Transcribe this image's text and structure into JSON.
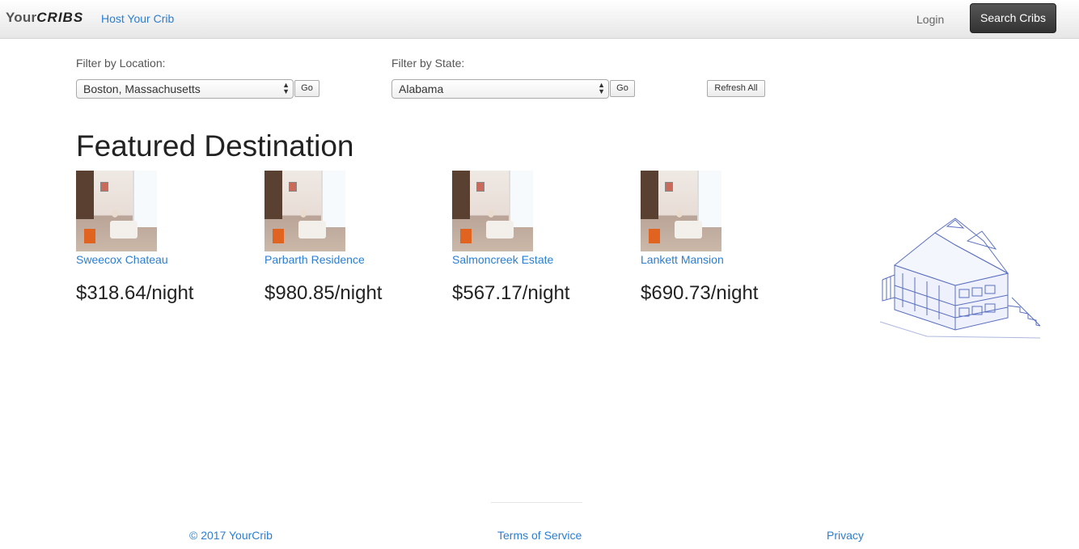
{
  "navbar": {
    "brand_prefix": "Your",
    "brand_suffix": "CRIBS",
    "host_link": "Host Your Crib",
    "login_link": "Login",
    "search_button": "Search Cribs"
  },
  "filters": {
    "location": {
      "label": "Filter by Location:",
      "selected": "Boston, Massachusetts",
      "go_label": "Go"
    },
    "state": {
      "label": "Filter by State:",
      "selected": "Alabama",
      "go_label": "Go"
    },
    "refresh_label": "Refresh All"
  },
  "featured": {
    "title": "Featured Destination",
    "listings": [
      {
        "name": "Sweecox Chateau",
        "price": "$318.64/night"
      },
      {
        "name": "Parbarth Residence",
        "price": "$980.85/night"
      },
      {
        "name": "Salmoncreek Estate",
        "price": "$567.17/night"
      },
      {
        "name": "Lankett Mansion",
        "price": "$690.73/night"
      }
    ]
  },
  "footer": {
    "copyright": "© 2017 YourCrib",
    "terms": "Terms of Service",
    "privacy": "Privacy"
  },
  "colors": {
    "link": "#2a7ed3",
    "search_button_bg": "#444444",
    "sketch": "#5a6fc0"
  }
}
